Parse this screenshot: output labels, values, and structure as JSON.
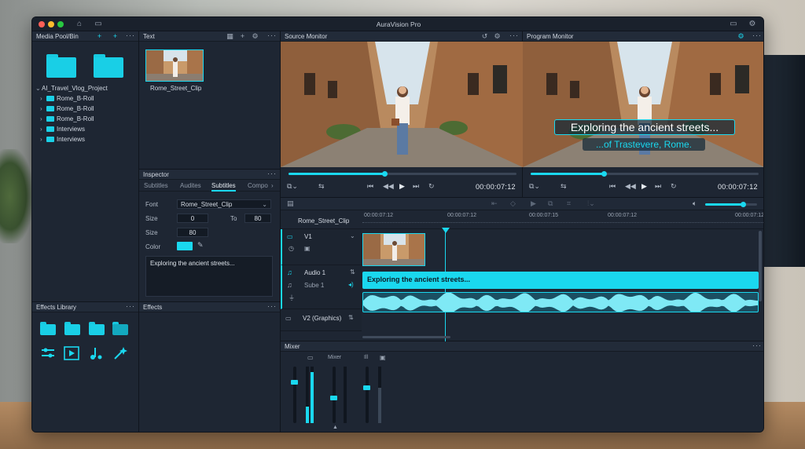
{
  "window": {
    "title": "AuraVision Pro"
  },
  "media_pool": {
    "title": "Media Pool/Bin",
    "tree": [
      {
        "label": "AI_Travel_Vlog_Project",
        "expanded": true
      },
      {
        "label": "Rome_B-Roll"
      },
      {
        "label": "Rome_B-Roll"
      },
      {
        "label": "Rome_B-Roll"
      },
      {
        "label": "Interviews"
      },
      {
        "label": "Interviews"
      }
    ]
  },
  "text_panel": {
    "title": "Text",
    "clip_name": "Rome_Street_Clip"
  },
  "source_monitor": {
    "title": "Source Monitor",
    "timecode": "00:00:07:12",
    "progress": 0.42
  },
  "program_monitor": {
    "title": "Program Monitor",
    "timecode": "00:00:07:12",
    "progress": 0.32,
    "subtitle_line1": "Exploring the ancient streets...",
    "subtitle_line2": "...of Trastevere, Rome."
  },
  "inspector": {
    "title": "Inspector",
    "tabs": [
      "Subtitles",
      "Audites",
      "Subtitles",
      "Compo"
    ],
    "active_tab": 2,
    "font_label": "Font",
    "font_value": "Rome_Street_Clip",
    "size_label": "Size",
    "size_value": "0",
    "to_label": "To",
    "to_value": "80",
    "size2_label": "Size",
    "size2_value": "80",
    "color_label": "Color",
    "color_value": "#1ad8ef",
    "text_content": "Exploring the ancient streets..."
  },
  "effects_library": {
    "title": "Effects Library"
  },
  "effects": {
    "title": "Effects"
  },
  "timeline": {
    "clip_name": "Rome_Street_Clip",
    "ruler": [
      "00:00:07:12",
      "00:00:07:12",
      "00:00:07:15",
      "00:00:07:12"
    ],
    "tracks": [
      {
        "name": "V1"
      },
      {
        "name": "Audio 1"
      },
      {
        "name": "Sube 1"
      },
      {
        "name": "V2 (Graphics)"
      }
    ],
    "subtitle_clip_text": "Exploring the ancient streets...",
    "volume": 0.72
  },
  "mixer": {
    "title": "Mixer",
    "channel_label": "Mixer",
    "channel2_label": "Ill",
    "levels": [
      0.72,
      0.9,
      0.45,
      0.62
    ]
  }
}
